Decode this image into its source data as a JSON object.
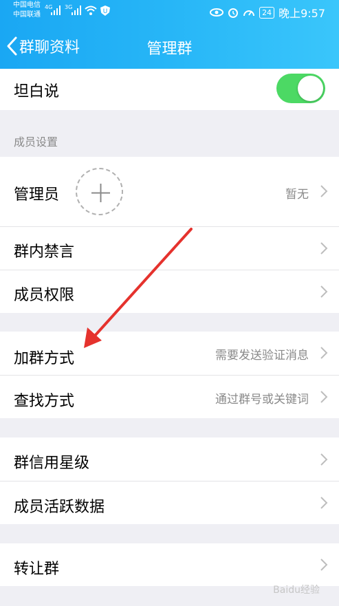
{
  "status_bar": {
    "carrier_1": "中国电信",
    "carrier_2": "中国联通",
    "sig_1": "4G",
    "sig_2": "3G",
    "battery": "24",
    "time": "晚上9:57"
  },
  "nav": {
    "back_label": "群聊资料",
    "title": "管理群"
  },
  "rows": {
    "tanbaishuo": {
      "label": "坦白说",
      "toggle_on": true
    },
    "section_member_settings": "成员设置",
    "admin": {
      "label": "管理员",
      "value": "暂无"
    },
    "mute": {
      "label": "群内禁言"
    },
    "permissions": {
      "label": "成员权限"
    },
    "join_method": {
      "label": "加群方式",
      "value": "需要发送验证消息"
    },
    "find_method": {
      "label": "查找方式",
      "value": "通过群号或关键词"
    },
    "credit": {
      "label": "群信用星级"
    },
    "activity": {
      "label": "成员活跃数据"
    },
    "transfer": {
      "label": "转让群"
    }
  },
  "watermark": "Baidu经验",
  "colors": {
    "header_start": "#1aa7f3",
    "header_end": "#3ac6fb",
    "toggle_on": "#4cd964",
    "annotation_arrow": "#e5322d"
  }
}
